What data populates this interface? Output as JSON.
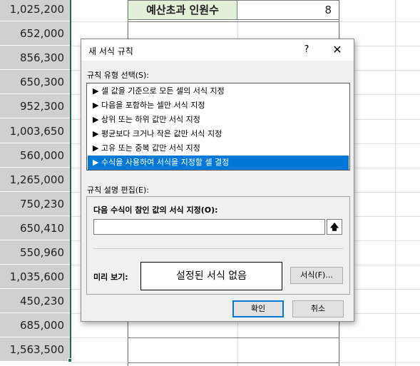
{
  "sheet": {
    "column_a_values": [
      "1,025,200",
      "652,000",
      "856,300",
      "650,300",
      "952,300",
      "1,003,650",
      "560,000",
      "1,265,000",
      "750,230",
      "650,410",
      "550,960",
      "1,035,600",
      "450,230",
      "685,000",
      "1,563,500"
    ],
    "summary_label": "예산초과 인원수",
    "summary_value": "8"
  },
  "dialog": {
    "title": "새 서식 규칙",
    "help_label": "?",
    "close_label": "✕",
    "rule_type_label": "규칙 유형 선택(S):",
    "rule_types": [
      "▶ 셀 값을 기준으로 모든 셀의 서식 지정",
      "▶ 다음을 포함하는 셀만 서식 지정",
      "▶ 상위 또는 하위 값만 서식 지정",
      "▶ 평균보다 크거나 작은 값만 서식 지정",
      "▶ 고유 또는 중복 값만 서식 지정",
      "▶ 수식을 사용하여 서식을 지정할 셀 결정"
    ],
    "selected_rule_index": 5,
    "edit_label": "규칙 설명 편집(E):",
    "formula_label": "다음 수식이 참인 값의 서식 지정(O):",
    "formula_value": "",
    "collapse_icon": "arrow-up-icon",
    "preview_label": "미리 보기:",
    "preview_text": "설정된 서식 없음",
    "format_button": "서식(F)...",
    "ok_button": "확인",
    "cancel_button": "취소"
  },
  "colors": {
    "selection_blue": "#0078d7",
    "highlight_red": "#e00000",
    "header_green": "#e2efd9",
    "column_gray": "#d0d0d0"
  }
}
